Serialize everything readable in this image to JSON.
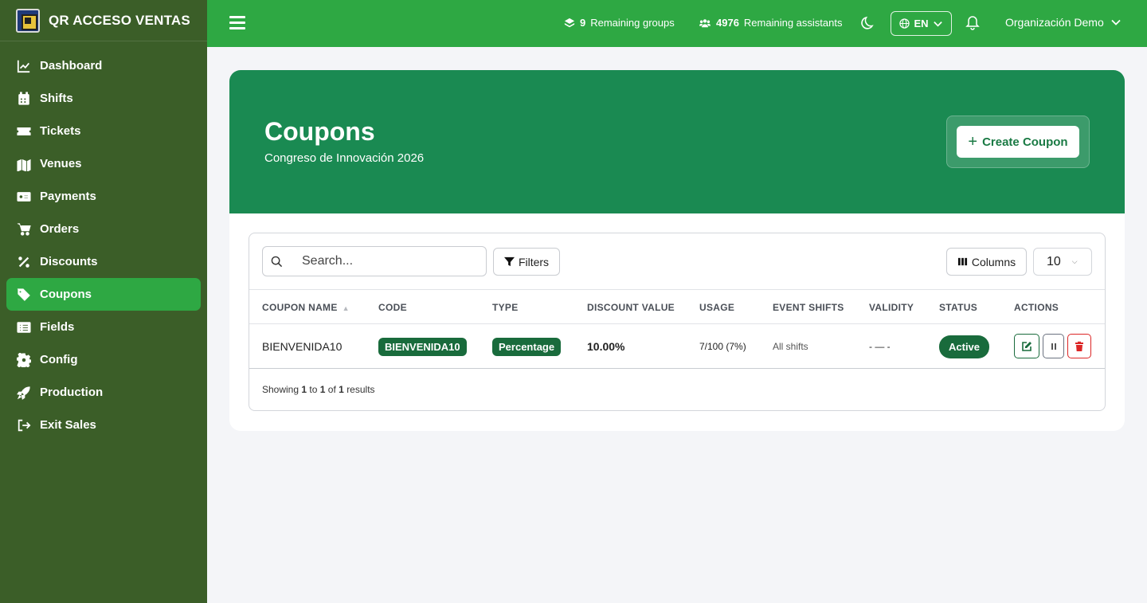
{
  "brand": {
    "name": "QR ACCESO VENTAS"
  },
  "sidebar": {
    "items": [
      {
        "label": "Dashboard",
        "icon": "chart-line-icon"
      },
      {
        "label": "Shifts",
        "icon": "calendar-icon"
      },
      {
        "label": "Tickets",
        "icon": "ticket-icon"
      },
      {
        "label": "Venues",
        "icon": "map-icon"
      },
      {
        "label": "Payments",
        "icon": "money-bill-icon"
      },
      {
        "label": "Orders",
        "icon": "cart-icon"
      },
      {
        "label": "Discounts",
        "icon": "percent-icon"
      },
      {
        "label": "Coupons",
        "icon": "tags-icon",
        "active": true
      },
      {
        "label": "Fields",
        "icon": "list-icon"
      },
      {
        "label": "Config",
        "icon": "gear-icon"
      },
      {
        "label": "Production",
        "icon": "rocket-icon"
      },
      {
        "label": "Exit Sales",
        "icon": "sign-out-icon"
      }
    ]
  },
  "topbar": {
    "groups_count": "9",
    "groups_label": "Remaining groups",
    "assistants_count": "4976",
    "assistants_label": "Remaining assistants",
    "language": "EN",
    "organization": "Organización Demo"
  },
  "hero": {
    "title": "Coupons",
    "subtitle": "Congreso de Innovación 2026",
    "create_button": "Create Coupon"
  },
  "toolbar": {
    "search_placeholder": "Search...",
    "filters_label": "Filters",
    "columns_label": "Columns",
    "per_page": "10"
  },
  "table": {
    "headers": {
      "name": "COUPON NAME",
      "code": "CODE",
      "type": "TYPE",
      "discount": "DISCOUNT VALUE",
      "usage": "USAGE",
      "shifts": "EVENT SHIFTS",
      "validity": "VALIDITY",
      "status": "STATUS",
      "actions": "ACTIONS"
    },
    "rows": [
      {
        "name": "BIENVENIDA10",
        "code": "BIENVENIDA10",
        "type": "Percentage",
        "discount": "10.00%",
        "usage": "7/100 (7%)",
        "shifts": "All shifts",
        "validity": "- — -",
        "status": "Active"
      }
    ]
  },
  "pagination": {
    "showing": "Showing",
    "from": "1",
    "to_word": "to",
    "to": "1",
    "of_word": "of",
    "total": "1",
    "results": "results"
  },
  "colors": {
    "sidebar_bg": "#3b5e28",
    "topbar_bg": "#2ea843",
    "hero_bg": "#1a8a52",
    "badge_bg": "#196b3c",
    "danger": "#dc2626"
  }
}
